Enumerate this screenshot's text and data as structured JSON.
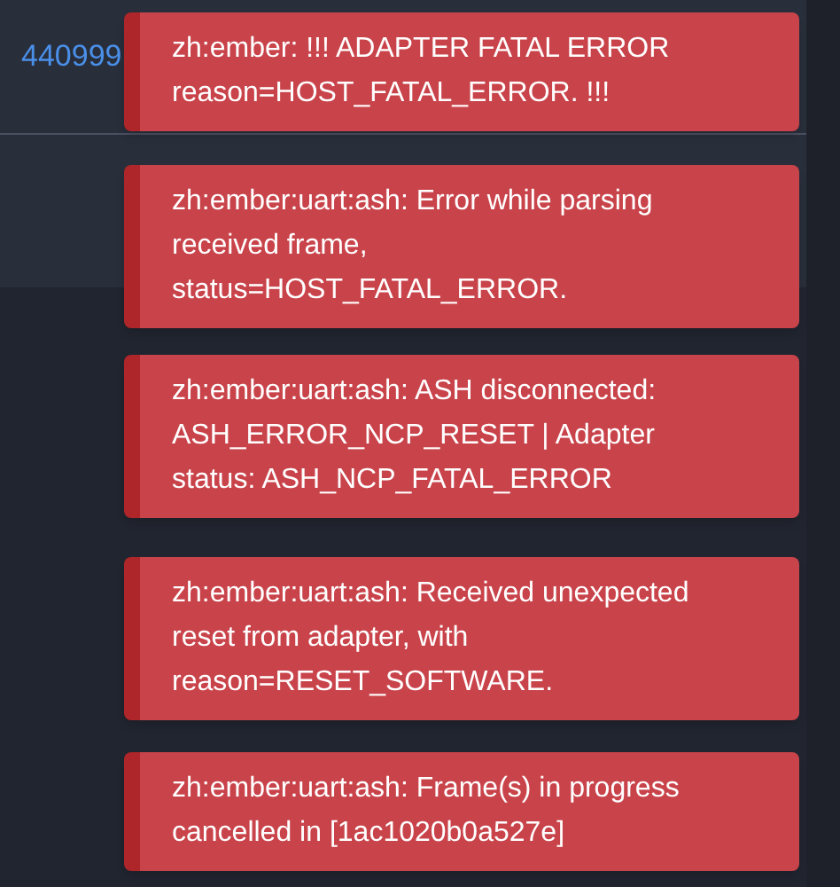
{
  "background_rows": [
    {
      "cell_text": "440999"
    },
    {
      "cell_text": null
    }
  ],
  "toasts": [
    {
      "kind": "error",
      "message": "zh:ember: !!! ADAPTER FATAL ERROR reason=HOST_FATAL_ERROR. !!!"
    },
    {
      "kind": "error",
      "message": "zh:ember:uart:ash: Error while parsing received frame, status=HOST_FATAL_ERROR."
    },
    {
      "kind": "error",
      "message": "zh:ember:uart:ash: ASH disconnected: ASH_ERROR_NCP_RESET | Adapter status: ASH_NCP_FATAL_ERROR"
    },
    {
      "kind": "error",
      "message": "zh:ember:uart:ash: Received unexpected reset from adapter, with reason=RESET_SOFTWARE."
    },
    {
      "kind": "error",
      "message": "zh:ember:uart:ash: Frame(s) in progress cancelled in [1ac1020b0a527e]"
    }
  ]
}
